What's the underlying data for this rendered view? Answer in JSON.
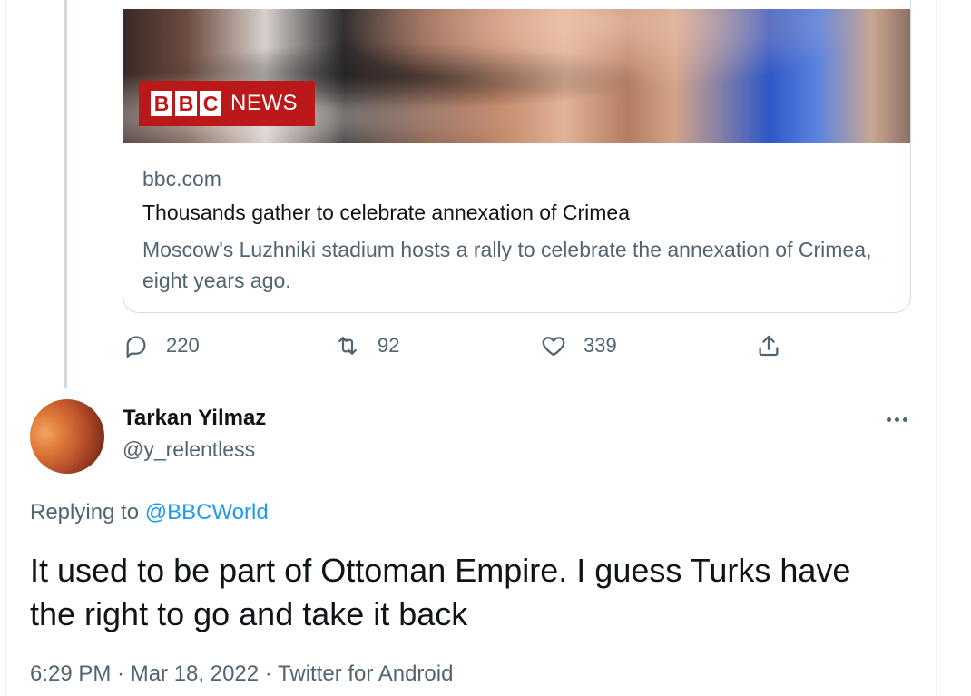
{
  "link_card": {
    "logo": {
      "blocks": [
        "B",
        "B",
        "C"
      ],
      "label": "NEWS",
      "color": "#bb1919"
    },
    "domain": "bbc.com",
    "title": "Thousands gather to celebrate annexation of Crimea",
    "description": "Moscow's Luzhniki stadium hosts a rally to celebrate the annexation of Crimea, eight years ago."
  },
  "actions": {
    "reply_count": "220",
    "retweet_count": "92",
    "like_count": "339",
    "icons": [
      "reply-icon",
      "retweet-icon",
      "like-icon",
      "share-icon"
    ]
  },
  "reply_tweet": {
    "display_name": "Tarkan Yilmaz",
    "handle": "@y_relentless",
    "replying_prefix": "Replying to",
    "replying_to": "@BBCWorld",
    "text": "It used to be part of Ottoman Empire. I guess Turks have the right to go and take it back",
    "timestamp": "6:29 PM · Mar 18, 2022 · Twitter for Android"
  },
  "colors": {
    "accent": "#1d9bf0",
    "secondary_text": "#536471",
    "primary_text": "#0f1419"
  }
}
